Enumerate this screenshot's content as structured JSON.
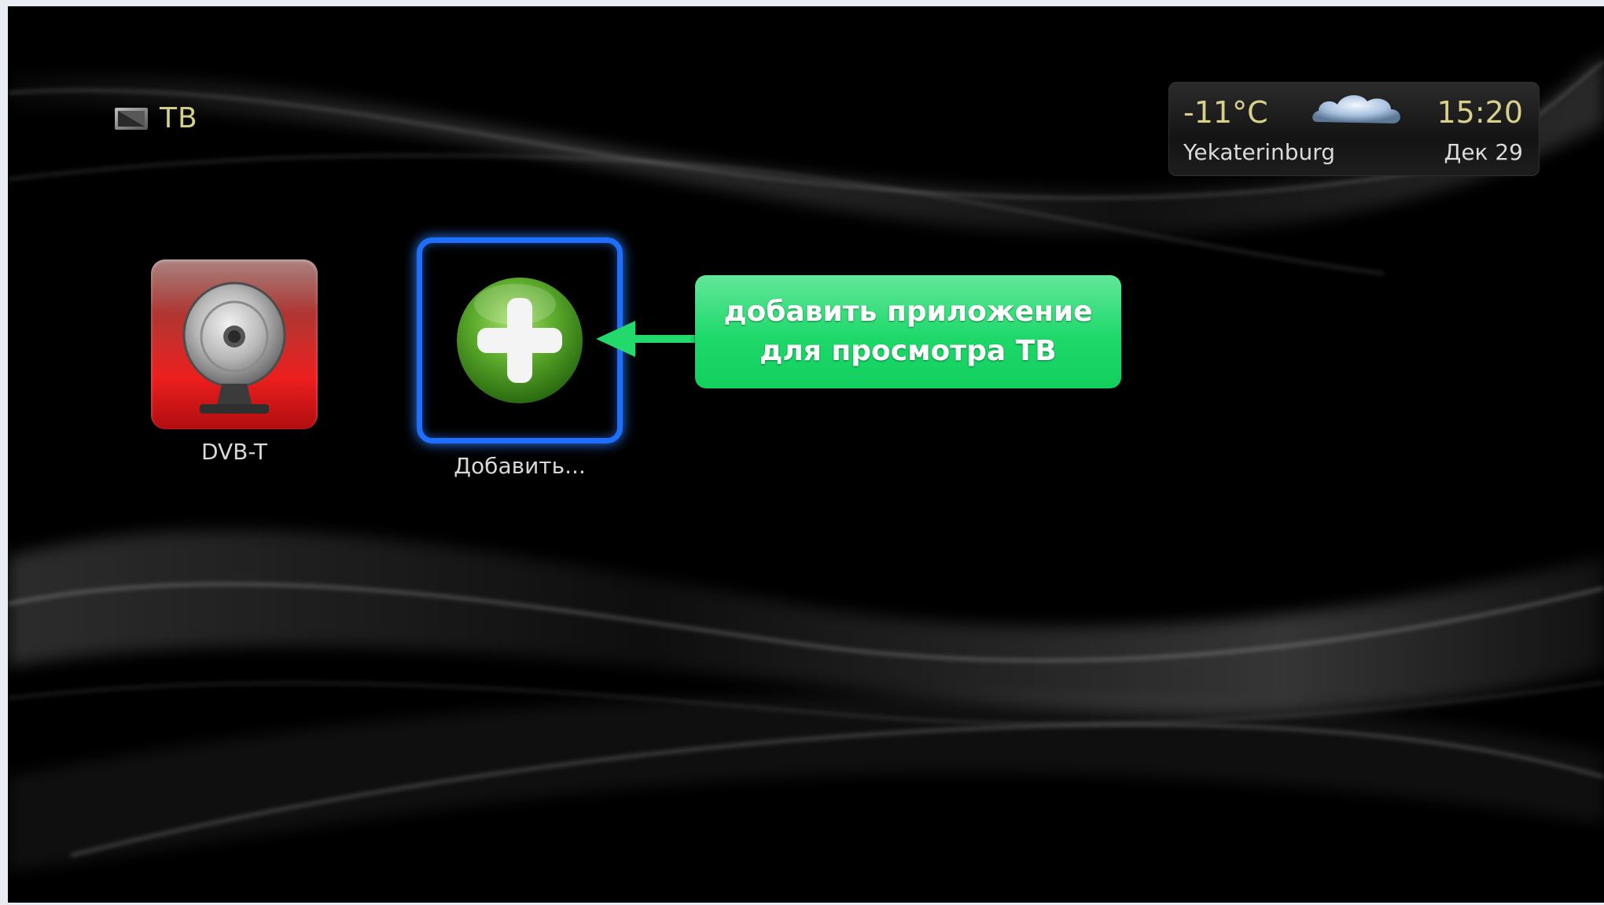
{
  "header": {
    "title": "ТВ",
    "icon": "tv-icon"
  },
  "weather": {
    "temperature": "-11°C",
    "icon": "cloud-icon",
    "time": "15:20",
    "city": "Yekaterinburg",
    "date": "Дек 29"
  },
  "apps": [
    {
      "label": "DVB-T",
      "icon": "antenna-icon",
      "selected": false
    },
    {
      "label": "Добавить...",
      "icon": "plus-icon",
      "selected": true
    }
  ],
  "callout": {
    "line1": "добавить приложение",
    "line2": "для просмотра ТВ",
    "color": "#22d96b"
  },
  "colors": {
    "accent_text": "#d9d189",
    "selection_border": "#1f6fff",
    "background": "#000000"
  }
}
